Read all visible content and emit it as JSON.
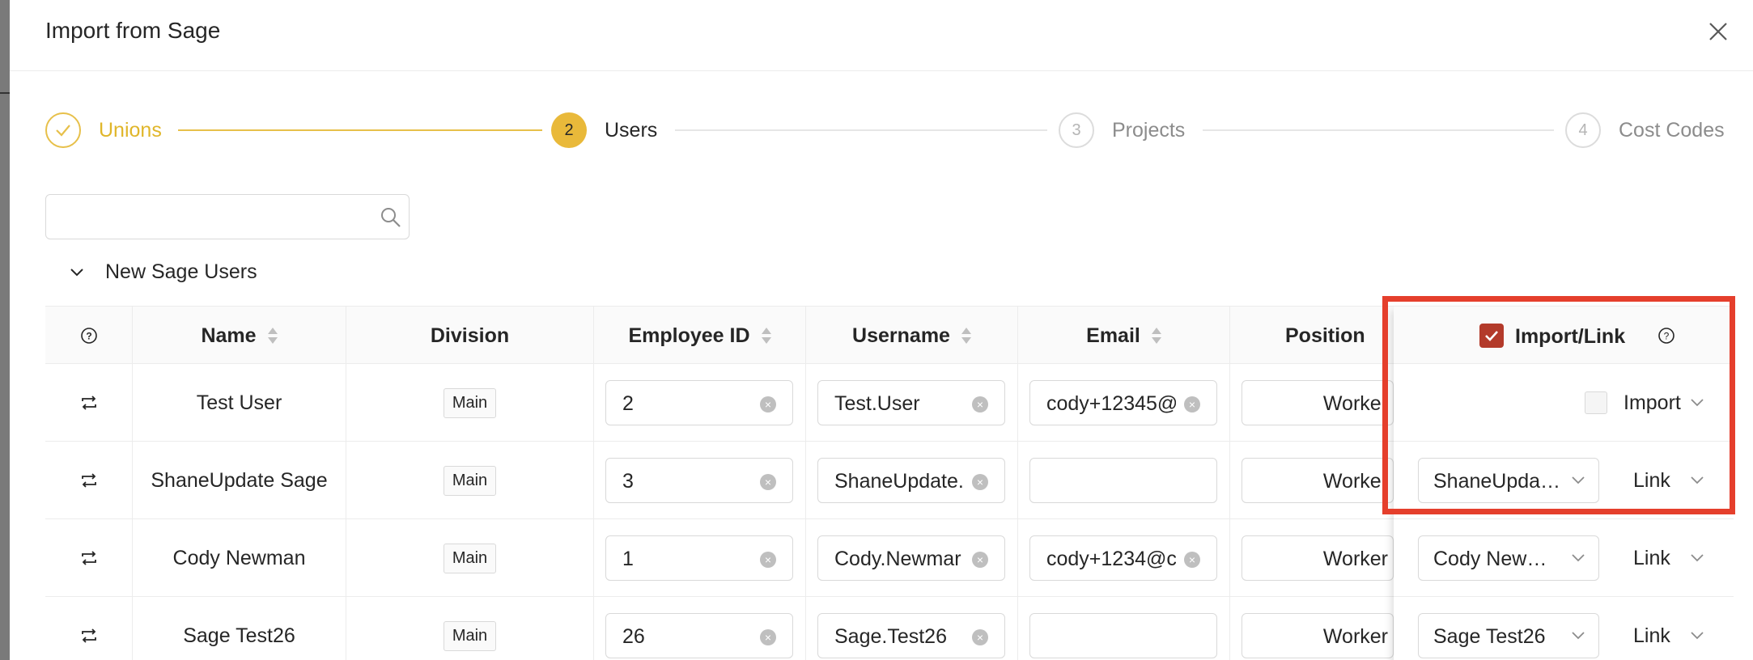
{
  "modal": {
    "title": "Import from Sage"
  },
  "steps": [
    {
      "number": "",
      "label": "Unions",
      "state": "done"
    },
    {
      "number": "2",
      "label": "Users",
      "state": "active"
    },
    {
      "number": "3",
      "label": "Projects",
      "state": "pending"
    },
    {
      "number": "4",
      "label": "Cost Codes",
      "state": "pending"
    }
  ],
  "search": {
    "value": "",
    "placeholder": ""
  },
  "section": {
    "label": "New Sage Users",
    "expanded": true
  },
  "table": {
    "headers": {
      "name": "Name",
      "division": "Division",
      "employee_id": "Employee ID",
      "username": "Username",
      "email": "Email",
      "position": "Position",
      "import_link": "Import/Link"
    },
    "rows": [
      {
        "name": "Test User",
        "division": "Main",
        "employee_id": "2",
        "username": "Test.User",
        "email": "cody+12345@",
        "position": "Worker",
        "link_user": "",
        "mode": "Import"
      },
      {
        "name": "ShaneUpdate Sage",
        "division": "Main",
        "employee_id": "3",
        "username": "ShaneUpdate.",
        "email": "",
        "position": "Worker",
        "link_user": "ShaneUpda…",
        "mode": "Link"
      },
      {
        "name": "Cody Newman",
        "division": "Main",
        "employee_id": "1",
        "username": "Cody.Newmar",
        "email": "cody+1234@c",
        "position": "Worker",
        "link_user": "Cody New…",
        "mode": "Link"
      },
      {
        "name": "Sage Test26",
        "division": "Main",
        "employee_id": "26",
        "username": "Sage.Test26",
        "email": "",
        "position": "Worker",
        "link_user": "Sage Test26",
        "mode": "Link"
      }
    ]
  },
  "colors": {
    "accent": "#e9b93a",
    "checkbox_checked": "#b33a2a",
    "highlight": "#e53f2c"
  },
  "icons": {
    "close": "close-icon",
    "search": "search-icon",
    "help": "help-circle-icon",
    "row": "repeat-icon",
    "check": "check-icon",
    "chevron": "chevron-down-icon"
  }
}
